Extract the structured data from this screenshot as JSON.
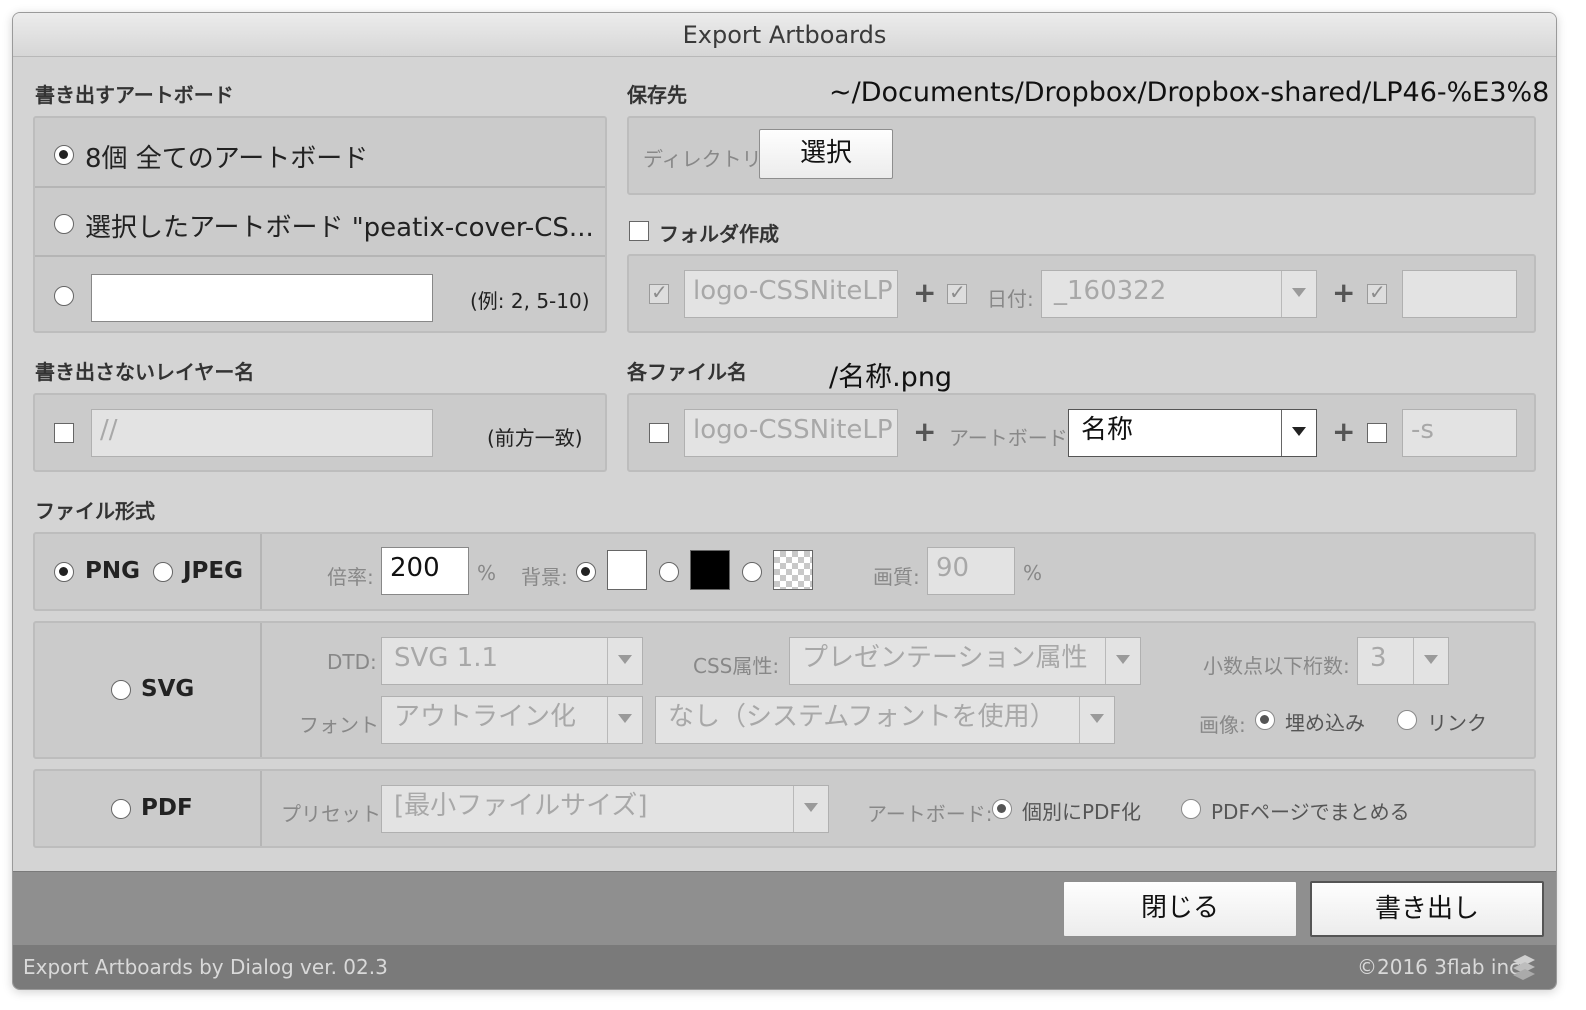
{
  "window": {
    "title": "Export Artboards"
  },
  "artboards": {
    "heading": "書き出すアートボード",
    "all_option": "8個 全てのアートボード",
    "selected_option": "選択したアートボード \"peatix-cover-CS...",
    "range_value": "",
    "range_hint": "(例: 2, 5-10)"
  },
  "save_to": {
    "heading": "保存先",
    "path": "~/Documents/Dropbox/Dropbox-shared/LP46-%E3%8",
    "directory_label": "ディレクトリ:",
    "choose_button": "選択"
  },
  "folder": {
    "heading": "フォルダ作成",
    "prefix_value": "logo-CSSNiteLP",
    "date_label": "日付:",
    "date_value": "_160322",
    "suffix_value": ""
  },
  "exclude_layer": {
    "heading": "書き出さないレイヤー名",
    "value": "//",
    "hint": "(前方一致)"
  },
  "filename": {
    "heading": "各ファイル名",
    "pattern": "/名称.png",
    "prefix_value": "logo-CSSNiteLP",
    "artboard_label": "アートボード:",
    "artboard_select": "名称",
    "suffix_value": "-s"
  },
  "format": {
    "heading": "ファイル形式",
    "png_label": "PNG",
    "jpeg_label": "JPEG",
    "scale_label": "倍率:",
    "scale_value": "200",
    "percent": "%",
    "background_label": "背景:",
    "quality_label": "画質:",
    "quality_value": "90",
    "quality_percent": "%"
  },
  "svg": {
    "label": "SVG",
    "dtd_label": "DTD:",
    "dtd_value": "SVG 1.1",
    "css_label": "CSS属性:",
    "css_value": "プレゼンテーション属性",
    "decimal_label": "小数点以下桁数:",
    "decimal_value": "3",
    "font_label": "フォント:",
    "font_value": "アウトライン化",
    "font_subset_value": "なし（システムフォントを使用）",
    "image_label": "画像:",
    "embed_label": "埋め込み",
    "link_label": "リンク"
  },
  "pdf": {
    "label": "PDF",
    "preset_label": "プリセット:",
    "preset_value": "[最小ファイルサイズ]",
    "artboard_label": "アートボード:",
    "individual_label": "個別にPDF化",
    "combine_label": "PDFページでまとめる"
  },
  "buttons": {
    "close": "閉じる",
    "export": "書き出し"
  },
  "status": {
    "left": "Export Artboards by Dialog ver. 02.3",
    "right": "©2016 3flab inc."
  },
  "colors": {
    "background_black": "#000000",
    "background_white": "#ffffff"
  }
}
